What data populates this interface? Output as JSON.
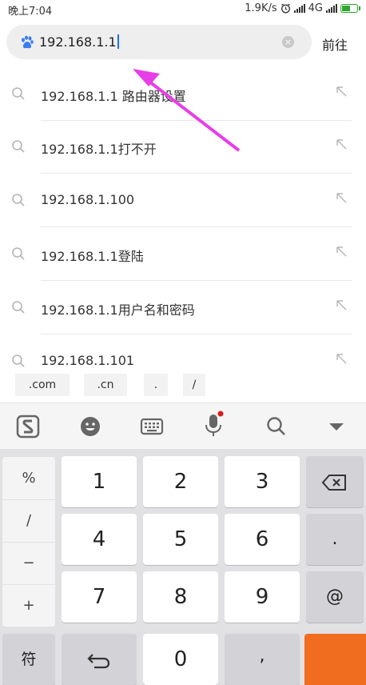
{
  "status_bar": {
    "time": "晚上7:04",
    "network_speed": "1.9K/s",
    "network_type": "4G",
    "battery_color": "#2fa52f",
    "battery_level_fraction": 0.6,
    "icons": [
      "alarm-icon",
      "signal-icon",
      "signal-icon",
      "battery-charging-icon"
    ]
  },
  "search": {
    "engine_icon": "baidu-paw-icon",
    "query": "192.168.1.1",
    "clear_icon": "clear-icon",
    "go_label": "前往"
  },
  "suggestions": [
    {
      "text": "192.168.1.1 路由器设置"
    },
    {
      "text": "192.168.1.1打不开"
    },
    {
      "text": "192.168.1.100"
    },
    {
      "text": "192.168.1.1登陆"
    },
    {
      "text": "192.168.1.1用户名和密码"
    },
    {
      "text": "192.168.1.101"
    }
  ],
  "shortcuts": [
    ".com",
    ".cn",
    ".",
    "/"
  ],
  "keyboard_toolbar": [
    "sogou-logo-icon",
    "emoji-icon",
    "keyboard-icon",
    "microphone-icon",
    "search-icon",
    "collapse-icon"
  ],
  "keyboard": {
    "symbols": [
      "%",
      "/",
      "−",
      "+"
    ],
    "rows": [
      [
        "1",
        "2",
        "3"
      ],
      [
        "4",
        "5",
        "6"
      ],
      [
        "7",
        "8",
        "9"
      ]
    ],
    "right_keys": [
      "⌫",
      ".",
      "@"
    ],
    "bottom": {
      "fu": "符",
      "undo": "↶",
      "zero": "0",
      "dot": ","
    }
  },
  "colors": {
    "accent": "#1e6de8",
    "annotation_arrow": "#e83ee8",
    "enter_key": "#f06c1e"
  }
}
